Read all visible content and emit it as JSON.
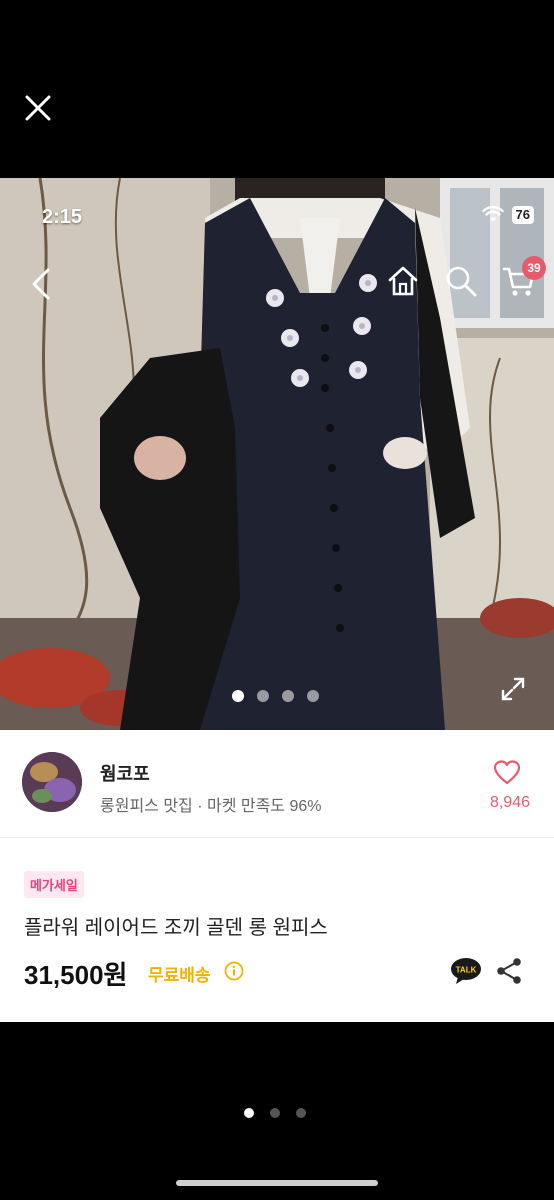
{
  "viewer": {
    "close_icon": "close-icon",
    "page_dots": {
      "count": 3,
      "active": 1
    }
  },
  "status_bar": {
    "time": "2:15",
    "battery": "76"
  },
  "nav": {
    "icons": [
      "back-icon",
      "home-icon",
      "search-icon",
      "cart-icon"
    ],
    "cart_count": "39"
  },
  "photo": {
    "carousel": {
      "count": 4,
      "active": 1
    }
  },
  "shop": {
    "name": "웜코포",
    "subtitle": "롱원피스 맛집 · 마켓 만족도 96%",
    "likes": "8,946"
  },
  "product": {
    "badge": "메가세일",
    "title": "플라워 레이어드 조끼 골덴 롱 원피스",
    "price": "31,500원",
    "shipping": "무료배송"
  },
  "colors": {
    "accent_pink": "#e85a6b",
    "badge_bg": "#fde7f0",
    "badge_text": "#e0457b",
    "shipping_yellow": "#f0b400"
  }
}
